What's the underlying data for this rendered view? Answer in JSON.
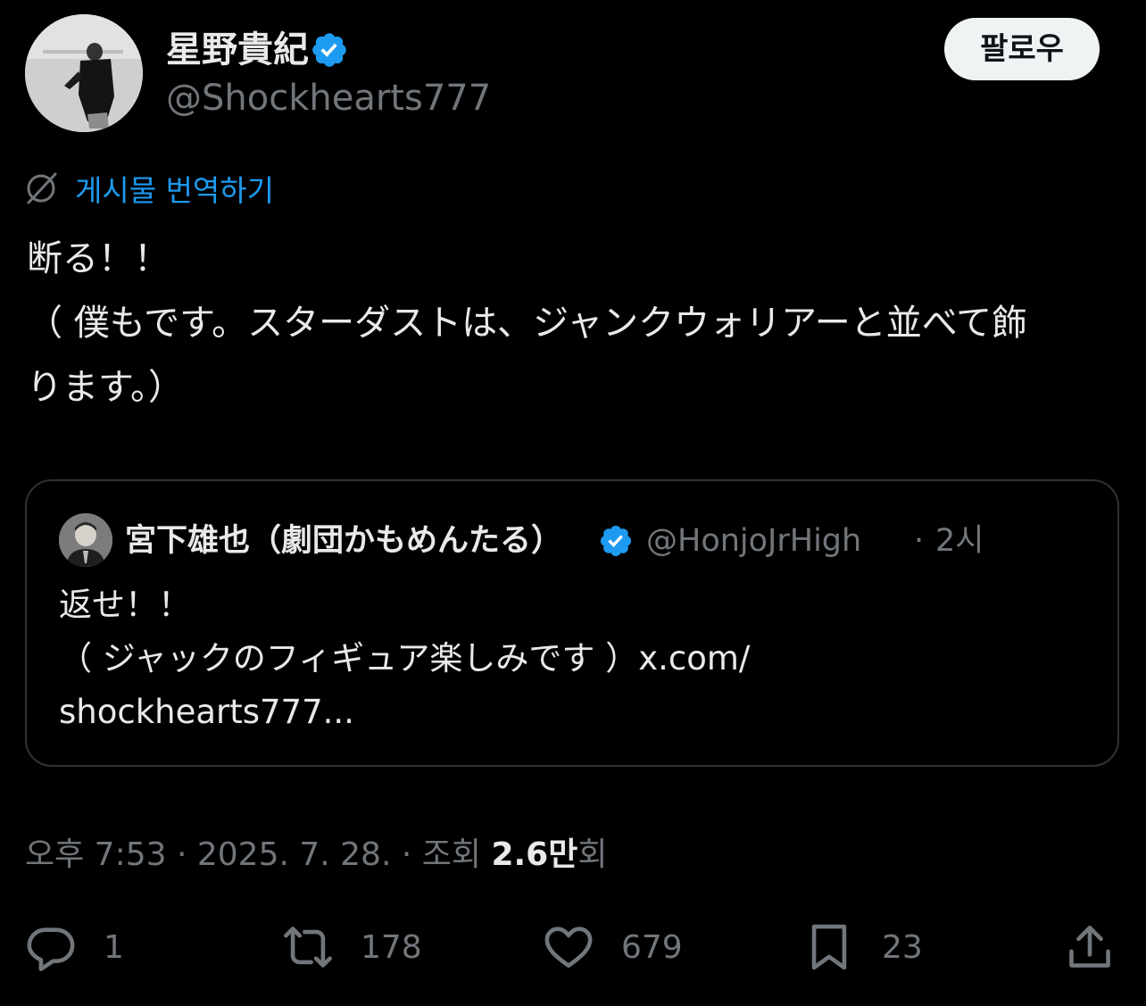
{
  "post": {
    "author_name": "星野貴紀",
    "author_handle": "@Shockhearts777",
    "follow_label": "팔로우",
    "translate_label": "게시물 번역하기",
    "body_lines": [
      "断る！！",
      "（ 僕もです。スターダストは、ジャンクウォリアーと並べて飾",
      "ります。）"
    ],
    "timestamp": "오후 7:53 · 2025. 7. 28. · 조회",
    "views_value": "2.6만",
    "views_suffix": "회"
  },
  "quote": {
    "author_name": "宮下雄也（劇団かもめんたる）",
    "author_handle": "@HonjoJrHigh",
    "separator": "·",
    "time": "2시",
    "body_lines": [
      "返せ！！",
      "（ ジャックのフィギュア楽しみです ）x.com/",
      "shockhearts777..."
    ]
  },
  "actions": {
    "replies": "1",
    "reposts": "178",
    "likes": "679",
    "bookmarks": "23"
  },
  "icons": {
    "verified": "verified-badge-icon",
    "translate": "globe-slash-icon",
    "reply": "reply-icon",
    "repost": "repost-icon",
    "like": "heart-icon",
    "bookmark": "bookmark-icon",
    "share": "share-icon"
  },
  "colors": {
    "background": "#000000",
    "text": "#e7e9ea",
    "secondary": "#71767b",
    "accent": "#1d9bf0",
    "border": "#2f3336"
  }
}
